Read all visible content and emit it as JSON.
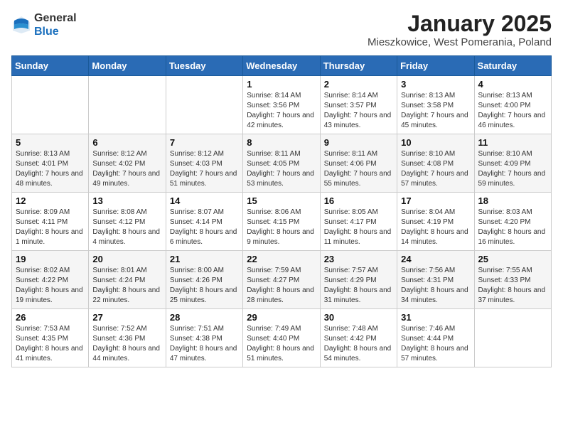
{
  "header": {
    "logo_line1": "General",
    "logo_line2": "Blue",
    "month_title": "January 2025",
    "location": "Mieszkowice, West Pomerania, Poland"
  },
  "weekdays": [
    "Sunday",
    "Monday",
    "Tuesday",
    "Wednesday",
    "Thursday",
    "Friday",
    "Saturday"
  ],
  "weeks": [
    [
      {
        "day": "",
        "sunrise": "",
        "sunset": "",
        "daylight": ""
      },
      {
        "day": "",
        "sunrise": "",
        "sunset": "",
        "daylight": ""
      },
      {
        "day": "",
        "sunrise": "",
        "sunset": "",
        "daylight": ""
      },
      {
        "day": "1",
        "sunrise": "Sunrise: 8:14 AM",
        "sunset": "Sunset: 3:56 PM",
        "daylight": "Daylight: 7 hours and 42 minutes."
      },
      {
        "day": "2",
        "sunrise": "Sunrise: 8:14 AM",
        "sunset": "Sunset: 3:57 PM",
        "daylight": "Daylight: 7 hours and 43 minutes."
      },
      {
        "day": "3",
        "sunrise": "Sunrise: 8:13 AM",
        "sunset": "Sunset: 3:58 PM",
        "daylight": "Daylight: 7 hours and 45 minutes."
      },
      {
        "day": "4",
        "sunrise": "Sunrise: 8:13 AM",
        "sunset": "Sunset: 4:00 PM",
        "daylight": "Daylight: 7 hours and 46 minutes."
      }
    ],
    [
      {
        "day": "5",
        "sunrise": "Sunrise: 8:13 AM",
        "sunset": "Sunset: 4:01 PM",
        "daylight": "Daylight: 7 hours and 48 minutes."
      },
      {
        "day": "6",
        "sunrise": "Sunrise: 8:12 AM",
        "sunset": "Sunset: 4:02 PM",
        "daylight": "Daylight: 7 hours and 49 minutes."
      },
      {
        "day": "7",
        "sunrise": "Sunrise: 8:12 AM",
        "sunset": "Sunset: 4:03 PM",
        "daylight": "Daylight: 7 hours and 51 minutes."
      },
      {
        "day": "8",
        "sunrise": "Sunrise: 8:11 AM",
        "sunset": "Sunset: 4:05 PM",
        "daylight": "Daylight: 7 hours and 53 minutes."
      },
      {
        "day": "9",
        "sunrise": "Sunrise: 8:11 AM",
        "sunset": "Sunset: 4:06 PM",
        "daylight": "Daylight: 7 hours and 55 minutes."
      },
      {
        "day": "10",
        "sunrise": "Sunrise: 8:10 AM",
        "sunset": "Sunset: 4:08 PM",
        "daylight": "Daylight: 7 hours and 57 minutes."
      },
      {
        "day": "11",
        "sunrise": "Sunrise: 8:10 AM",
        "sunset": "Sunset: 4:09 PM",
        "daylight": "Daylight: 7 hours and 59 minutes."
      }
    ],
    [
      {
        "day": "12",
        "sunrise": "Sunrise: 8:09 AM",
        "sunset": "Sunset: 4:11 PM",
        "daylight": "Daylight: 8 hours and 1 minute."
      },
      {
        "day": "13",
        "sunrise": "Sunrise: 8:08 AM",
        "sunset": "Sunset: 4:12 PM",
        "daylight": "Daylight: 8 hours and 4 minutes."
      },
      {
        "day": "14",
        "sunrise": "Sunrise: 8:07 AM",
        "sunset": "Sunset: 4:14 PM",
        "daylight": "Daylight: 8 hours and 6 minutes."
      },
      {
        "day": "15",
        "sunrise": "Sunrise: 8:06 AM",
        "sunset": "Sunset: 4:15 PM",
        "daylight": "Daylight: 8 hours and 9 minutes."
      },
      {
        "day": "16",
        "sunrise": "Sunrise: 8:05 AM",
        "sunset": "Sunset: 4:17 PM",
        "daylight": "Daylight: 8 hours and 11 minutes."
      },
      {
        "day": "17",
        "sunrise": "Sunrise: 8:04 AM",
        "sunset": "Sunset: 4:19 PM",
        "daylight": "Daylight: 8 hours and 14 minutes."
      },
      {
        "day": "18",
        "sunrise": "Sunrise: 8:03 AM",
        "sunset": "Sunset: 4:20 PM",
        "daylight": "Daylight: 8 hours and 16 minutes."
      }
    ],
    [
      {
        "day": "19",
        "sunrise": "Sunrise: 8:02 AM",
        "sunset": "Sunset: 4:22 PM",
        "daylight": "Daylight: 8 hours and 19 minutes."
      },
      {
        "day": "20",
        "sunrise": "Sunrise: 8:01 AM",
        "sunset": "Sunset: 4:24 PM",
        "daylight": "Daylight: 8 hours and 22 minutes."
      },
      {
        "day": "21",
        "sunrise": "Sunrise: 8:00 AM",
        "sunset": "Sunset: 4:26 PM",
        "daylight": "Daylight: 8 hours and 25 minutes."
      },
      {
        "day": "22",
        "sunrise": "Sunrise: 7:59 AM",
        "sunset": "Sunset: 4:27 PM",
        "daylight": "Daylight: 8 hours and 28 minutes."
      },
      {
        "day": "23",
        "sunrise": "Sunrise: 7:57 AM",
        "sunset": "Sunset: 4:29 PM",
        "daylight": "Daylight: 8 hours and 31 minutes."
      },
      {
        "day": "24",
        "sunrise": "Sunrise: 7:56 AM",
        "sunset": "Sunset: 4:31 PM",
        "daylight": "Daylight: 8 hours and 34 minutes."
      },
      {
        "day": "25",
        "sunrise": "Sunrise: 7:55 AM",
        "sunset": "Sunset: 4:33 PM",
        "daylight": "Daylight: 8 hours and 37 minutes."
      }
    ],
    [
      {
        "day": "26",
        "sunrise": "Sunrise: 7:53 AM",
        "sunset": "Sunset: 4:35 PM",
        "daylight": "Daylight: 8 hours and 41 minutes."
      },
      {
        "day": "27",
        "sunrise": "Sunrise: 7:52 AM",
        "sunset": "Sunset: 4:36 PM",
        "daylight": "Daylight: 8 hours and 44 minutes."
      },
      {
        "day": "28",
        "sunrise": "Sunrise: 7:51 AM",
        "sunset": "Sunset: 4:38 PM",
        "daylight": "Daylight: 8 hours and 47 minutes."
      },
      {
        "day": "29",
        "sunrise": "Sunrise: 7:49 AM",
        "sunset": "Sunset: 4:40 PM",
        "daylight": "Daylight: 8 hours and 51 minutes."
      },
      {
        "day": "30",
        "sunrise": "Sunrise: 7:48 AM",
        "sunset": "Sunset: 4:42 PM",
        "daylight": "Daylight: 8 hours and 54 minutes."
      },
      {
        "day": "31",
        "sunrise": "Sunrise: 7:46 AM",
        "sunset": "Sunset: 4:44 PM",
        "daylight": "Daylight: 8 hours and 57 minutes."
      },
      {
        "day": "",
        "sunrise": "",
        "sunset": "",
        "daylight": ""
      }
    ]
  ]
}
